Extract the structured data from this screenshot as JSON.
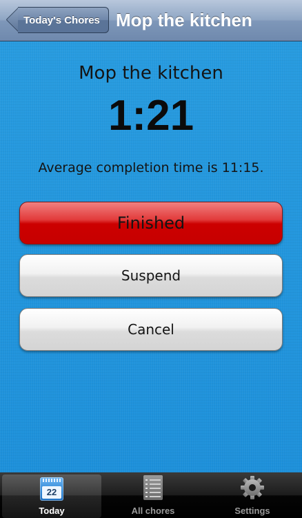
{
  "navbar": {
    "back_label": "Today's Chores",
    "title": "Mop the kitchen"
  },
  "main": {
    "chore_title": "Mop the kitchen",
    "timer": "1:21",
    "average_text": "Average completion time is 11:15.",
    "buttons": {
      "finished": "Finished",
      "suspend": "Suspend",
      "cancel": "Cancel"
    }
  },
  "tabbar": {
    "tabs": [
      {
        "label": "Today",
        "icon": "calendar-icon",
        "icon_text": "22",
        "selected": true
      },
      {
        "label": "All chores",
        "icon": "list-icon",
        "selected": false
      },
      {
        "label": "Settings",
        "icon": "gear-icon",
        "selected": false
      }
    ]
  },
  "colors": {
    "background": "#1f93de",
    "finished_button": "#cc0000",
    "neutral_button": "#e6e6e6",
    "navbar": "#8fa6c4",
    "tabbar": "#1c1c1c"
  }
}
